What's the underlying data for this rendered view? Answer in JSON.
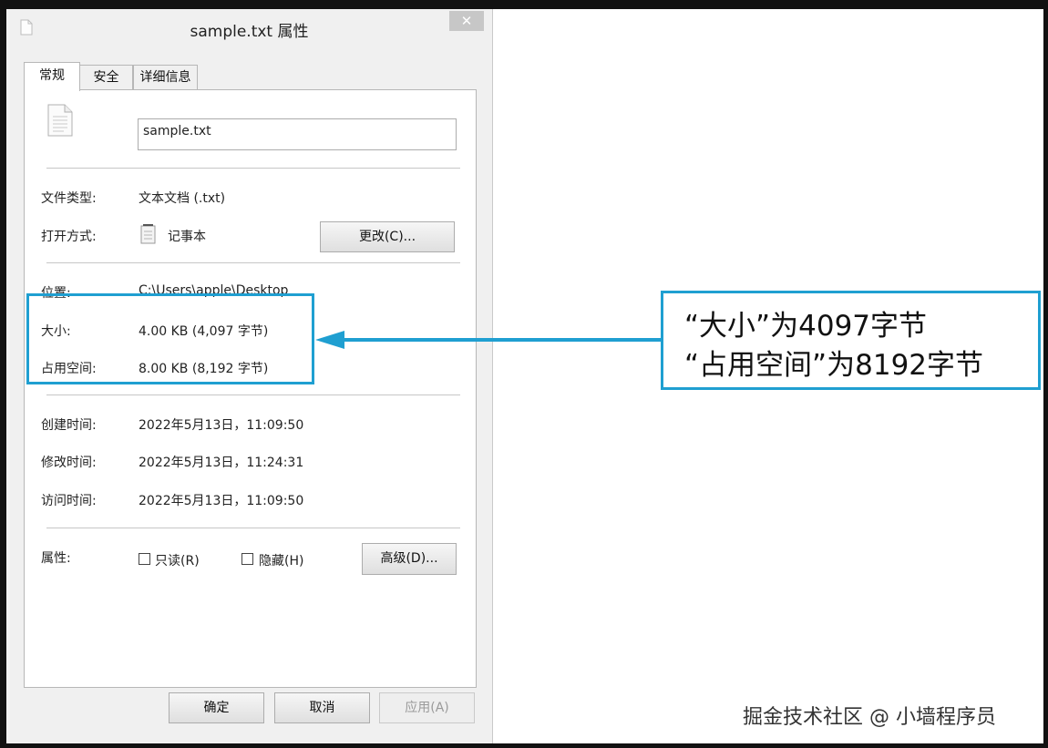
{
  "window": {
    "title": "sample.txt 属性",
    "close_label": "✕"
  },
  "tabs": [
    "常规",
    "安全",
    "详细信息"
  ],
  "general": {
    "filename": "sample.txt",
    "file_type_label": "文件类型:",
    "file_type_value": "文本文档 (.txt)",
    "opens_with_label": "打开方式:",
    "opens_with_value": "记事本",
    "change_button": "更改(C)...",
    "location_label": "位置:",
    "location_value": "C:\\Users\\apple\\Desktop",
    "size_label": "大小:",
    "size_value": "4.00 KB (4,097 字节)",
    "size_on_disk_label": "占用空间:",
    "size_on_disk_value": "8.00 KB (8,192 字节)",
    "created_label": "创建时间:",
    "created_value": "2022年5月13日，11:09:50",
    "modified_label": "修改时间:",
    "modified_value": "2022年5月13日，11:24:31",
    "accessed_label": "访问时间:",
    "accessed_value": "2022年5月13日，11:09:50",
    "attributes_label": "属性:",
    "readonly_label": "只读(R)",
    "hidden_label": "隐藏(H)",
    "advanced_button": "高级(D)..."
  },
  "footer": {
    "ok": "确定",
    "cancel": "取消",
    "apply": "应用(A)"
  },
  "annotation": {
    "line1": "“大小”为4097字节",
    "line2": "“占用空间”为8192字节",
    "accent_color": "#1f9fd1"
  },
  "watermark": "掘金技术社区 @ 小墙程序员"
}
